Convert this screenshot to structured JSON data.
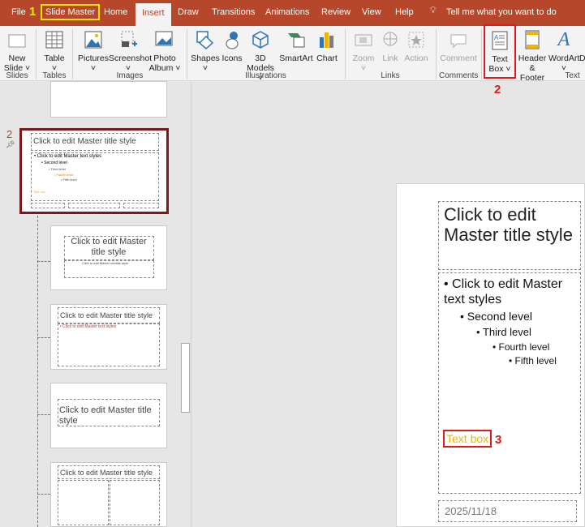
{
  "tabs": [
    "File",
    "Slide Master",
    "Home",
    "Insert",
    "Draw",
    "Transitions",
    "Animations",
    "Review",
    "View",
    "Help"
  ],
  "tell_me": "Tell me what you want to do",
  "ribbon": {
    "buttons": [
      {
        "l1": "New",
        "l2": "Slide ˅"
      },
      {
        "l1": "Table",
        "l2": "˅"
      },
      {
        "l1": "Pictures",
        "l2": "˅"
      },
      {
        "l1": "Screenshot",
        "l2": "˅"
      },
      {
        "l1": "Photo",
        "l2": "Album ˅"
      },
      {
        "l1": "Shapes",
        "l2": "˅"
      },
      {
        "l1": "Icons",
        "l2": ""
      },
      {
        "l1": "3D",
        "l2": "Models ˅"
      },
      {
        "l1": "SmartArt",
        "l2": ""
      },
      {
        "l1": "Chart",
        "l2": ""
      },
      {
        "l1": "Zoom",
        "l2": "˅"
      },
      {
        "l1": "Link",
        "l2": ""
      },
      {
        "l1": "Action",
        "l2": ""
      },
      {
        "l1": "Comment",
        "l2": ""
      },
      {
        "l1": "Text",
        "l2": "Box ˅"
      },
      {
        "l1": "Header",
        "l2": "& Footer"
      },
      {
        "l1": "WordArt",
        "l2": "˅"
      },
      {
        "l1": "D",
        "l2": ""
      }
    ],
    "groups": [
      "Slides",
      "Tables",
      "Images",
      "Illustrations",
      "Links",
      "Comments",
      "Text"
    ]
  },
  "annotations": [
    "1",
    "2",
    "3"
  ],
  "thumbs": {
    "slide_number": "2",
    "master_title": "Click to edit Master title style",
    "master_text": "• Click to edit Master text styles",
    "second": "• Second level",
    "third": "• Third level",
    "fourth": "• Fourth level",
    "fifth": "• Fifth level",
    "textbox": "Text box",
    "title_two_line": "Click to edit Master title style",
    "subtitle": "Click to edit Master subtitle style"
  },
  "slide": {
    "title": "Click to edit Master title style",
    "l1": "Click to edit Master text styles",
    "l2": "Second level",
    "l3": "Third level",
    "l4": "Fourth level",
    "l5": "Fifth level",
    "textbox": "Text box",
    "date": "2025/11/18"
  },
  "colors": {
    "accent": "#b7472a",
    "textbox": "#f0b400",
    "annotation": "#e01a1a"
  }
}
